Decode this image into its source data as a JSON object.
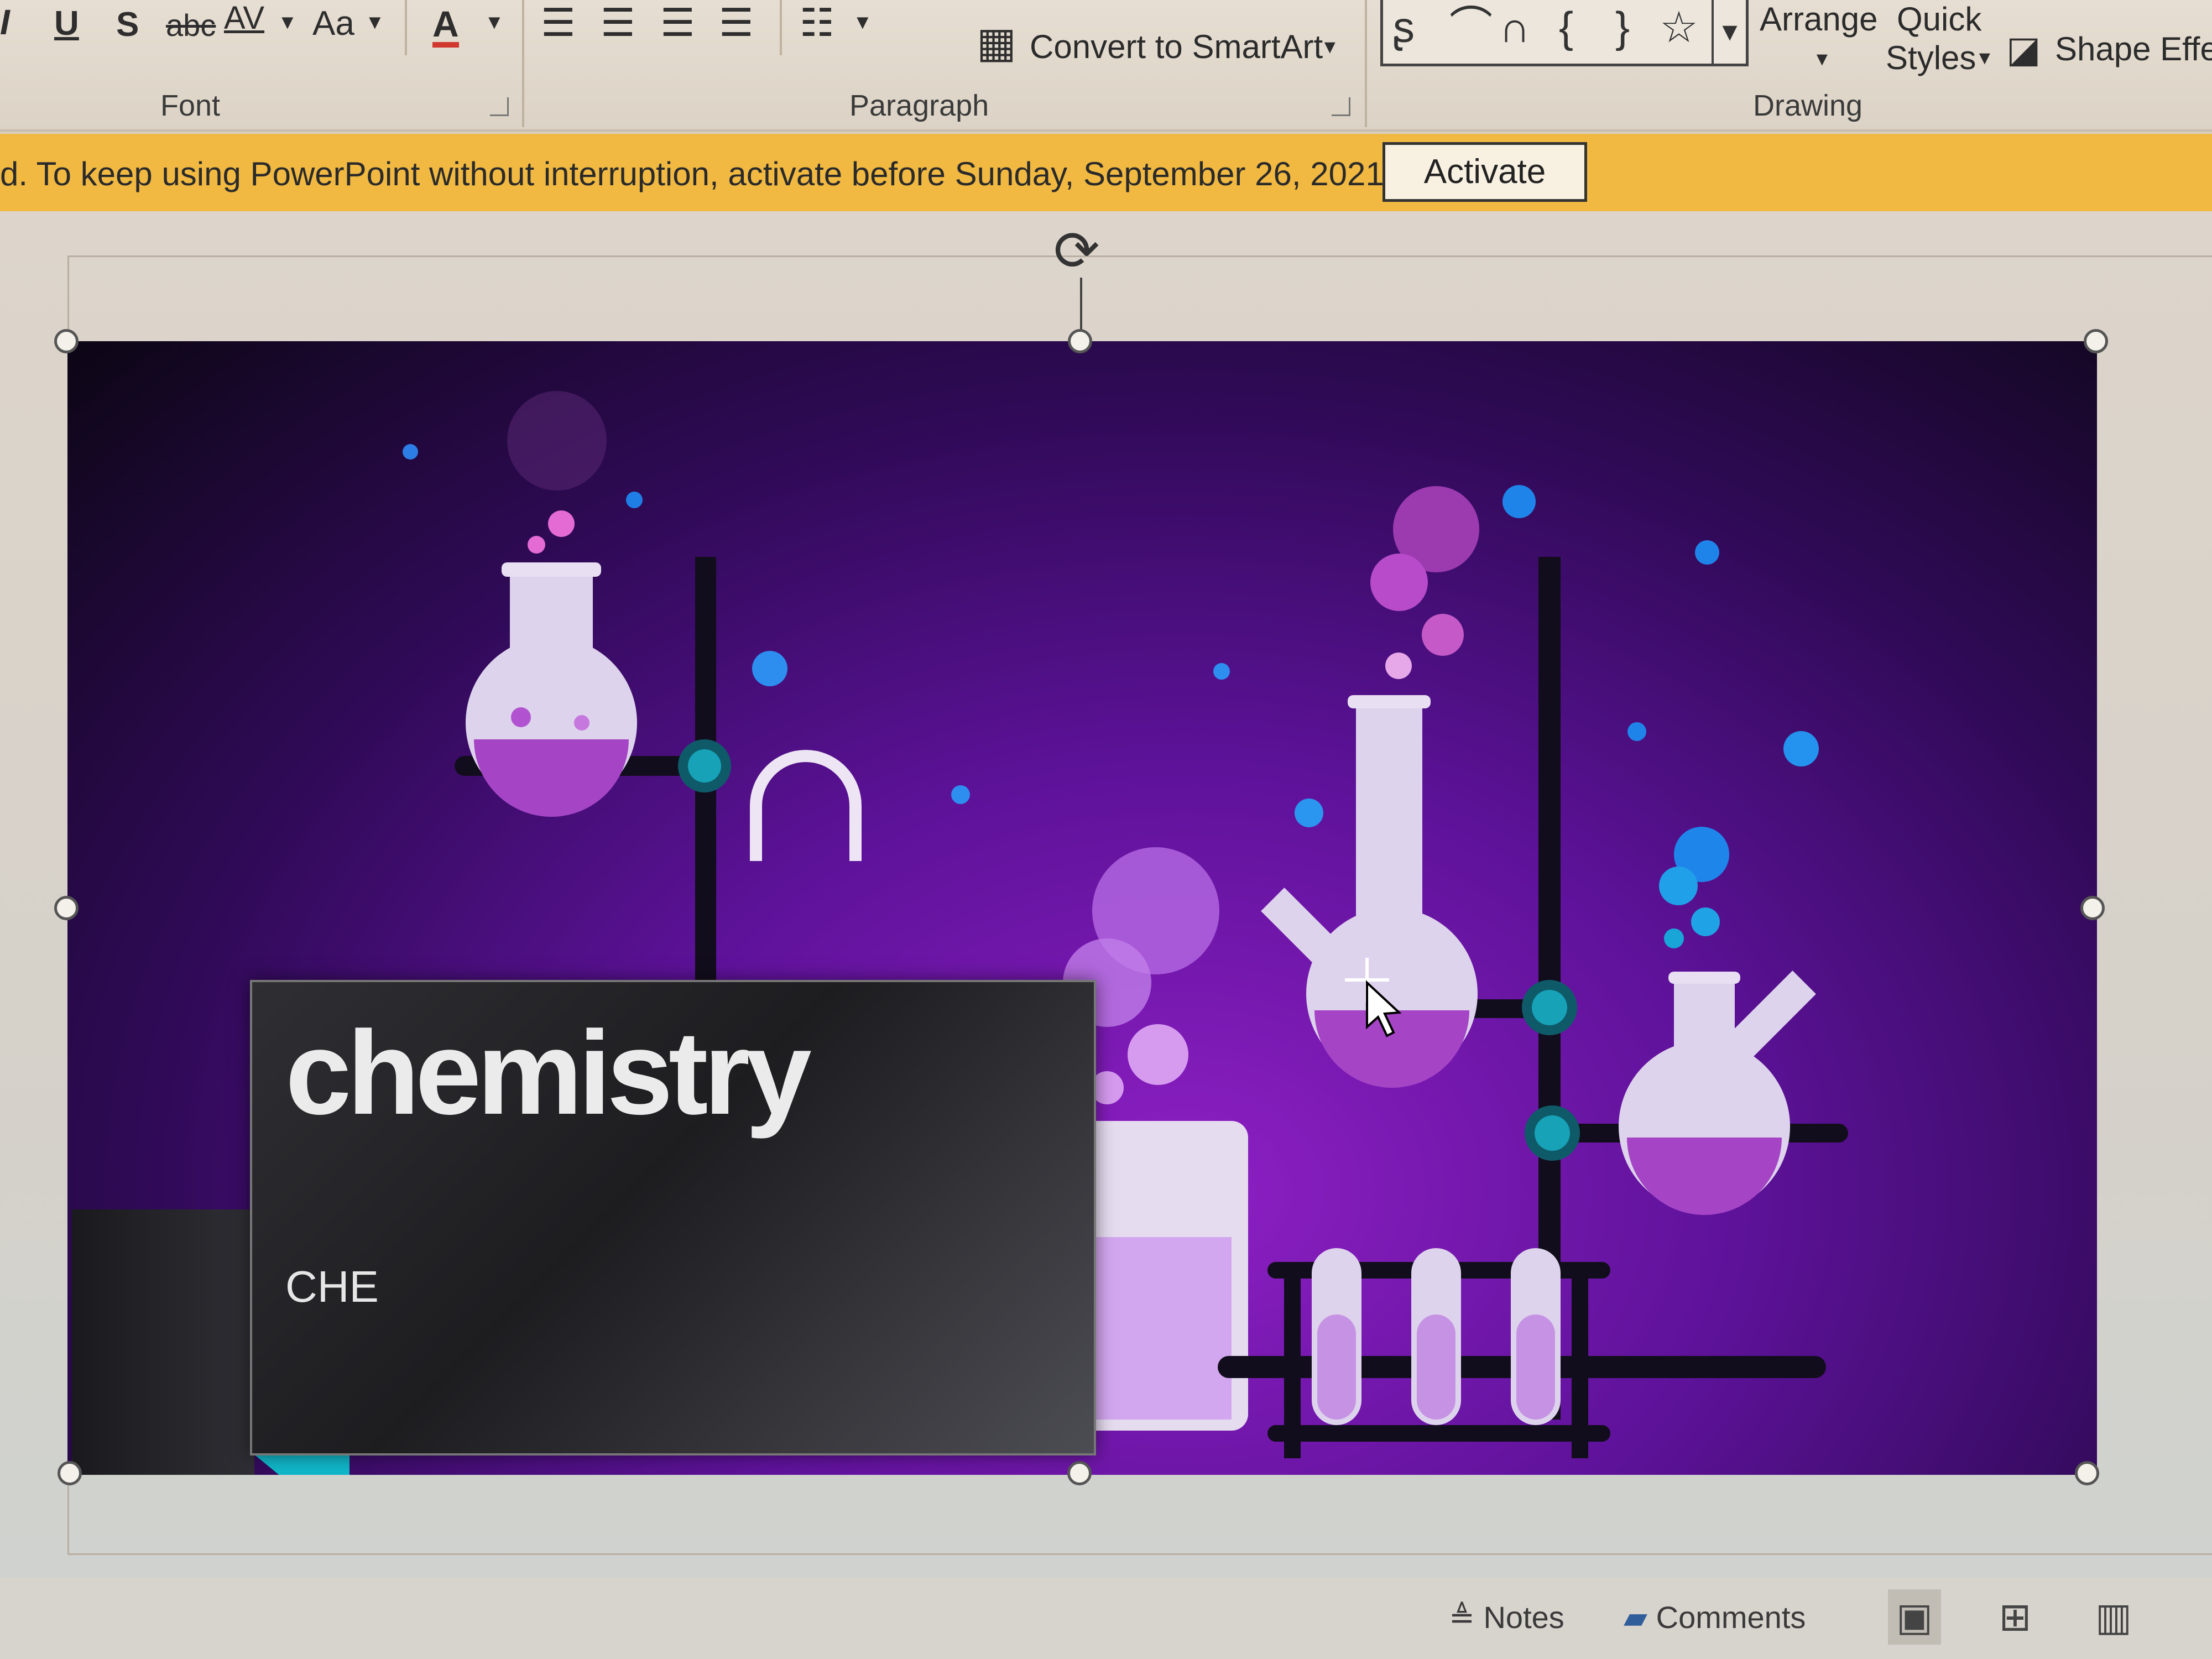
{
  "ribbon": {
    "font_tools": {
      "italic": "I",
      "underline": "U",
      "shadow": "S",
      "strikethrough": "abc",
      "char_spacing": "AV",
      "change_case": "Aa",
      "font_color": "A"
    },
    "groups": {
      "font_label": "Font",
      "paragraph_label": "Paragraph",
      "drawing_label": "Drawing"
    },
    "convert_smartart_label": "Convert to SmartArt",
    "arrange_label": "Arrange",
    "quick_styles_label_1": "Quick",
    "quick_styles_label_2": "Styles",
    "shape_effects_label": "Shape Effe"
  },
  "activation": {
    "message": "d. To keep using PowerPoint without interruption, activate before Sunday, September 26, 2021.",
    "button_label": "Activate"
  },
  "slide": {
    "title": "chemistry",
    "subtitle": "CHE"
  },
  "status_bar": {
    "notes_label": "Notes",
    "comments_label": "Comments"
  },
  "colors": {
    "ribbon_bg": "#e2d9cc",
    "activation_bar": "#f1b941",
    "slide_purple": "#7a1ab8",
    "teal_accent": "#10b7c9",
    "title_box": "#2a2a2e"
  }
}
